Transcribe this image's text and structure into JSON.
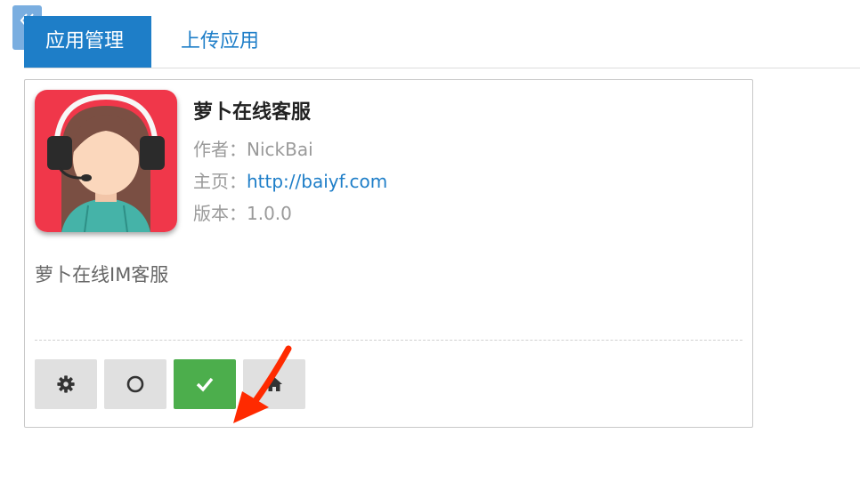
{
  "sidebar_toggle": {
    "icon": "double-chevron-left-icon"
  },
  "tabs": [
    {
      "label": "应用管理",
      "active": true
    },
    {
      "label": "上传应用",
      "active": false
    }
  ],
  "app": {
    "name": "萝卜在线客服",
    "author_label": "作者：",
    "author": "NickBai",
    "homepage_label": "主页：",
    "homepage": "http://baiyf.com",
    "version_label": "版本：",
    "version": "1.0.0",
    "description": "萝卜在线IM客服",
    "icon": "headset-avatar-icon"
  },
  "actions": [
    {
      "icon": "gear-icon",
      "active": false
    },
    {
      "icon": "circle-icon",
      "active": false
    },
    {
      "icon": "check-icon",
      "active": true
    },
    {
      "icon": "home-icon",
      "active": false
    }
  ],
  "colors": {
    "accent": "#1e7ec8",
    "success": "#4cae4c",
    "icon_background": "#f0374a",
    "annotation_arrow": "#ff2a00"
  }
}
